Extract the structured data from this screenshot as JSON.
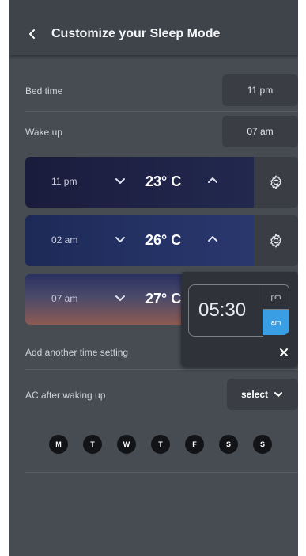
{
  "header": {
    "title": "Customize your Sleep Mode"
  },
  "bed_time": {
    "label": "Bed time",
    "value": "11 pm"
  },
  "wake_up": {
    "label": "Wake up",
    "value": "07 am"
  },
  "schedule": [
    {
      "time": "11 pm",
      "temp": "23° C"
    },
    {
      "time": "02 am",
      "temp": "26° C"
    },
    {
      "time": "07 am",
      "temp": "27° C"
    }
  ],
  "time_picker": {
    "time": "05:30",
    "pm": "pm",
    "am": "am",
    "selected": "am"
  },
  "add_time_setting": {
    "label": "Add another time setting"
  },
  "ac_after_waking": {
    "label": "AC after waking up",
    "select_label": "select"
  },
  "days": [
    "M",
    "T",
    "W",
    "T",
    "F",
    "S",
    "S"
  ]
}
